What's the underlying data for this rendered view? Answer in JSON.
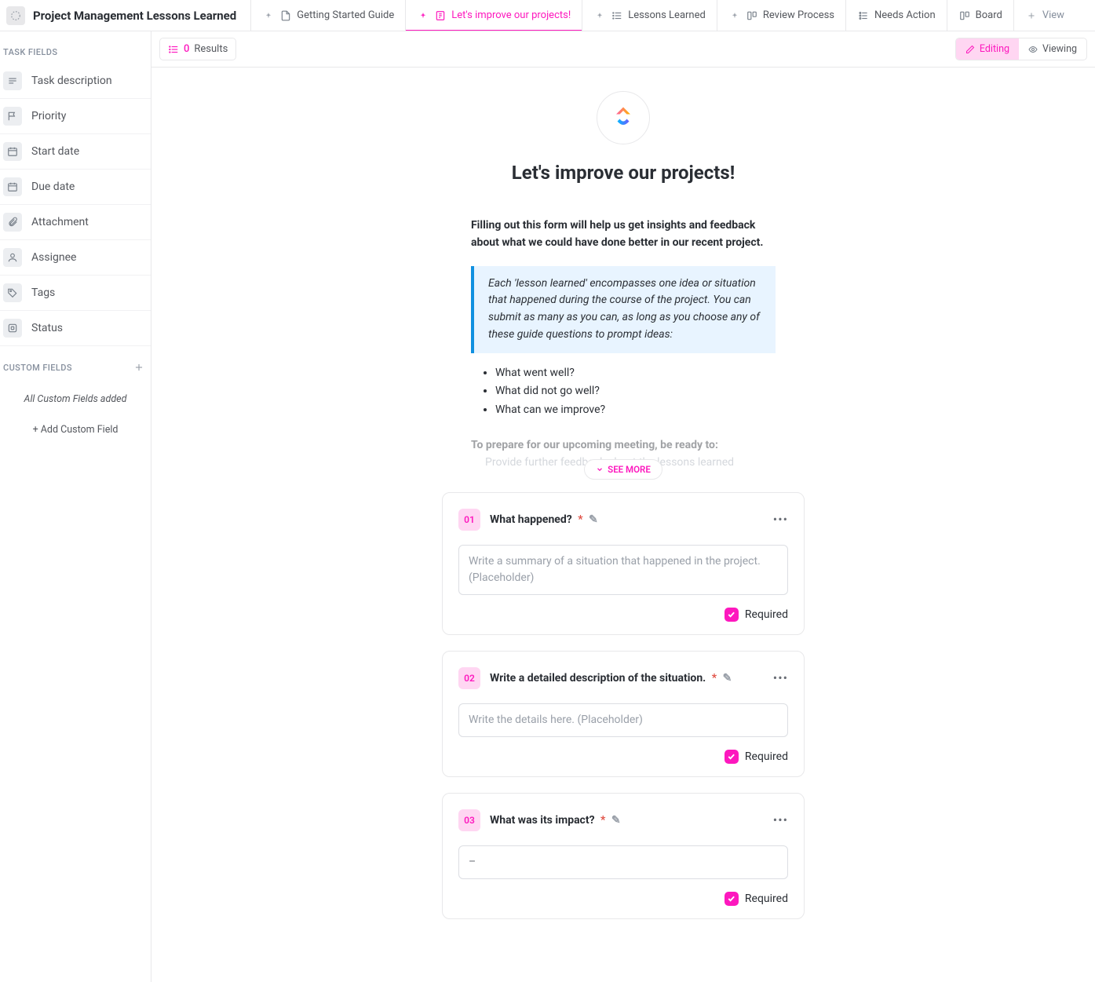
{
  "header": {
    "list_title": "Project Management Lessons Learned",
    "tabs": [
      {
        "label": "Getting Started Guide",
        "icon": "doc"
      },
      {
        "label": "Let's improve our projects!",
        "icon": "form",
        "active": true
      },
      {
        "label": "Lessons Learned",
        "icon": "list"
      },
      {
        "label": "Review Process",
        "icon": "board2"
      },
      {
        "label": "Needs Action",
        "icon": "list2"
      },
      {
        "label": "Board",
        "icon": "board"
      }
    ],
    "add_view_label": "View"
  },
  "toolbar": {
    "results": {
      "count": "0",
      "label": "Results"
    },
    "modes": {
      "editing": "Editing",
      "viewing": "Viewing"
    }
  },
  "sidebar": {
    "task_fields_heading": "TASK FIELDS",
    "items": [
      {
        "label": "Task description",
        "icon": "text"
      },
      {
        "label": "Priority",
        "icon": "flag"
      },
      {
        "label": "Start date",
        "icon": "calendar"
      },
      {
        "label": "Due date",
        "icon": "calendar"
      },
      {
        "label": "Attachment",
        "icon": "attach"
      },
      {
        "label": "Assignee",
        "icon": "user"
      },
      {
        "label": "Tags",
        "icon": "tag"
      },
      {
        "label": "Status",
        "icon": "status"
      }
    ],
    "custom_fields_heading": "CUSTOM FIELDS",
    "custom_fields_msg": "All Custom Fields added",
    "add_custom_field": "+ Add Custom Field"
  },
  "form": {
    "title": "Let's improve our projects!",
    "intro": "Filling out this form will help us get insights and feedback about what we could have done better in our recent project.",
    "callout": "Each 'lesson learned' encompasses one idea or situation that happened during the course of the project. You can submit as many as you can, as long as you choose any of these guide questions to prompt ideas:",
    "bullets": [
      "What went well?",
      "What did not go well?",
      "What can we improve?"
    ],
    "fade1": "To prepare for our upcoming meeting, be ready to:",
    "fade2": "Provide further feedback about the lessons learned",
    "see_more": "SEE MORE",
    "required_label": "Required",
    "questions": [
      {
        "num": "01",
        "title": "What happened?",
        "placeholder": "Write a summary of a situation that happened in the project. (Placeholder)",
        "multiline": true
      },
      {
        "num": "02",
        "title": "Write a detailed description of the situation.",
        "placeholder": "Write the details here. (Placeholder)",
        "multiline": false
      },
      {
        "num": "03",
        "title": "What was its impact?",
        "placeholder": "–",
        "dash": true
      }
    ]
  }
}
